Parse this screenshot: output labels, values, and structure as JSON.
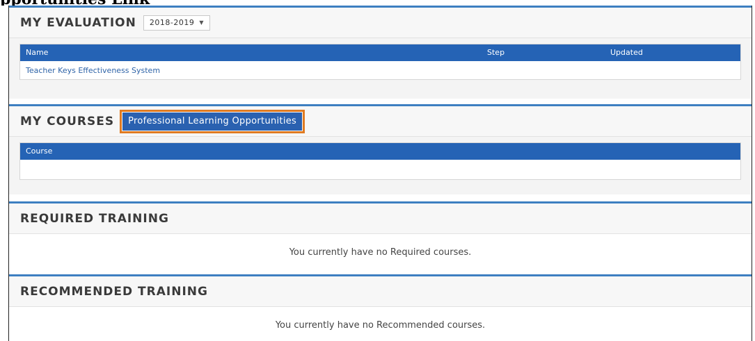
{
  "clipped_heading": "pportunities Link",
  "evaluation": {
    "title": "MY EVALUATION",
    "year_selected": "2018-2019",
    "columns": {
      "name": "Name",
      "step": "Step",
      "updated": "Updated"
    },
    "rows": [
      {
        "name": "Teacher Keys Effectiveness System",
        "step": "",
        "updated": ""
      }
    ]
  },
  "courses": {
    "title": "MY COURSES",
    "pl_button": "Professional Learning Opportunities",
    "column": "Course"
  },
  "required": {
    "title": "REQUIRED TRAINING",
    "message": "You currently have no Required courses."
  },
  "recommended": {
    "title": "RECOMMENDED TRAINING",
    "message": "You currently have no Recommended courses."
  },
  "colors": {
    "accent": "#3d7fc1",
    "header_blue": "#2563b5",
    "button_blue": "#2a61b0",
    "highlight_orange": "#e07b22"
  }
}
